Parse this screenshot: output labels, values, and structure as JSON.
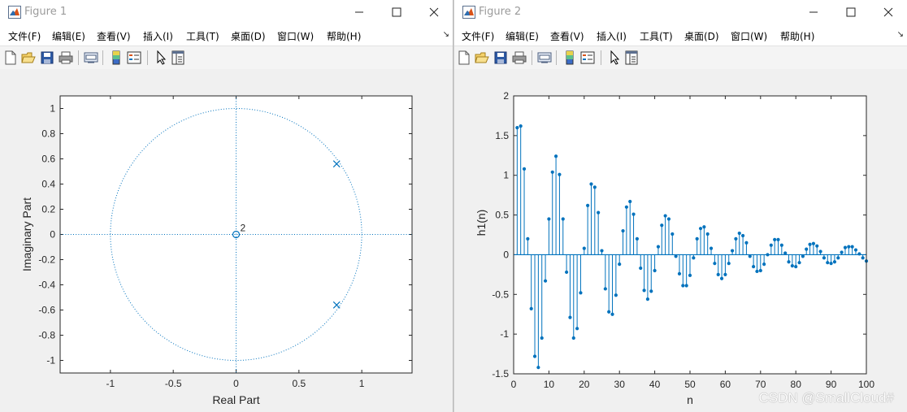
{
  "figure1": {
    "title": "Figure 1",
    "menu": [
      "文件(F)",
      "编辑(E)",
      "查看(V)",
      "插入(I)",
      "工具(T)",
      "桌面(D)",
      "窗口(W)",
      "帮助(H)"
    ],
    "chart_data": {
      "type": "scatter",
      "title": "",
      "xlabel": "Real Part",
      "ylabel": "Imaginary Part",
      "xlim": [
        -1.4,
        1.4
      ],
      "ylim": [
        -1.1,
        1.1
      ],
      "xticks": [
        "-1",
        "-0.5",
        "0",
        "0.5",
        "1"
      ],
      "yticks": [
        "1",
        "0.8",
        "0.6",
        "0.4",
        "0.2",
        "0",
        "-0.2",
        "-0.4",
        "-0.6",
        "-0.8",
        "-1"
      ],
      "unit_circle": true,
      "zeros": [
        {
          "re": 0,
          "im": 0,
          "multiplicity_label": "2"
        }
      ],
      "poles": [
        {
          "re": 0.8,
          "im": 0.56
        },
        {
          "re": 0.8,
          "im": -0.56
        }
      ],
      "color": "#0072bd"
    }
  },
  "figure2": {
    "title": "Figure 2",
    "menu": [
      "文件(F)",
      "编辑(E)",
      "查看(V)",
      "插入(I)",
      "工具(T)",
      "桌面(D)",
      "窗口(W)",
      "帮助(H)"
    ],
    "chart_data": {
      "type": "stem",
      "title": "",
      "xlabel": "n",
      "ylabel": "h1(n)",
      "xlim": [
        0,
        100
      ],
      "ylim": [
        -1.5,
        2
      ],
      "xticks": [
        "0",
        "10",
        "20",
        "30",
        "40",
        "50",
        "60",
        "70",
        "80",
        "90",
        "100"
      ],
      "yticks": [
        "2",
        "1.5",
        "1",
        "0.5",
        "0",
        "-0.5",
        "-1",
        "-1.5"
      ],
      "x": [
        1,
        2,
        3,
        4,
        5,
        6,
        7,
        8,
        9,
        10,
        11,
        12,
        13,
        14,
        15,
        16,
        17,
        18,
        19,
        20,
        21,
        22,
        23,
        24,
        25,
        26,
        27,
        28,
        29,
        30,
        31,
        32,
        33,
        34,
        35,
        36,
        37,
        38,
        39,
        40,
        41,
        42,
        43,
        44,
        45,
        46,
        47,
        48,
        49,
        50,
        51,
        52,
        53,
        54,
        55,
        56,
        57,
        58,
        59,
        60,
        61,
        62,
        63,
        64,
        65,
        66,
        67,
        68,
        69,
        70,
        71,
        72,
        73,
        74,
        75,
        76,
        77,
        78,
        79,
        80,
        81,
        82,
        83,
        84,
        85,
        86,
        87,
        88,
        89,
        90,
        91,
        92,
        93,
        94,
        95,
        96,
        97,
        98,
        99,
        100
      ],
      "values": [
        1.6,
        1.62,
        1.08,
        0.2,
        -0.68,
        -1.28,
        -1.42,
        -1.05,
        -0.33,
        0.45,
        1.04,
        1.24,
        1.01,
        0.45,
        -0.22,
        -0.79,
        -1.05,
        -0.93,
        -0.48,
        0.08,
        0.62,
        0.89,
        0.85,
        0.53,
        0.05,
        -0.43,
        -0.72,
        -0.75,
        -0.51,
        -0.12,
        0.3,
        0.6,
        0.67,
        0.51,
        0.2,
        -0.17,
        -0.45,
        -0.56,
        -0.46,
        -0.2,
        0.1,
        0.37,
        0.49,
        0.45,
        0.26,
        -0.02,
        -0.24,
        -0.39,
        -0.39,
        -0.26,
        -0.04,
        0.2,
        0.33,
        0.35,
        0.26,
        0.08,
        -0.11,
        -0.25,
        -0.3,
        -0.25,
        -0.11,
        0.05,
        0.2,
        0.27,
        0.24,
        0.15,
        -0.02,
        -0.15,
        -0.21,
        -0.2,
        -0.12,
        0.0,
        0.12,
        0.19,
        0.19,
        0.12,
        0.02,
        -0.09,
        -0.14,
        -0.15,
        -0.1,
        -0.02,
        0.07,
        0.13,
        0.14,
        0.11,
        0.04,
        -0.04,
        -0.1,
        -0.11,
        -0.09,
        -0.04,
        0.03,
        0.09,
        0.1,
        0.1,
        0.06,
        0.01,
        -0.04,
        -0.08
      ],
      "color": "#0072bd"
    }
  },
  "watermark": "CSDN @SmallCloud#"
}
